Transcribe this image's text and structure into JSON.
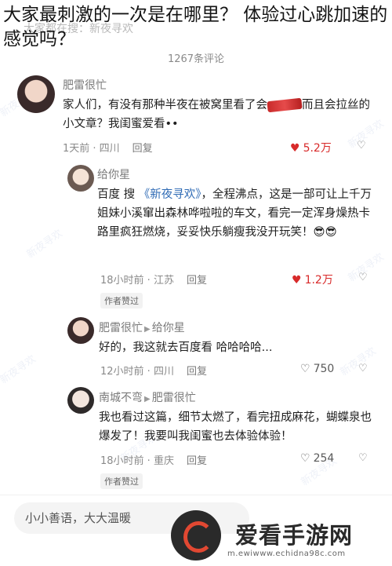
{
  "headline": "大家最刺激的一次是在哪里？ 体验过心跳加速的感觉吗？",
  "search_hint": "大家都在搜：新夜寻欢",
  "comment_count": "1267条评论",
  "watermark_text": "新夜寻欢",
  "comments": [
    {
      "name": "肥雷很忙",
      "text_before": "家人们，有没有那种半夜在被窝里看了会",
      "text_after": "而且会拉丝的小文章？我闺蜜爱看••",
      "time": "1天前 · 四川",
      "reply": "回复",
      "likes": "5.2万",
      "hot": true
    },
    {
      "name": "给你星",
      "text_prefix": "百度 搜",
      "link": "《新夜寻欢》",
      "text": "全程沸点，这是一部可让上千万姐妹小溪窜出森林哗啦啦的车文，看完一定浑身燥热卡路里疯狂燃烧，妥妥快乐躺瘦我没开玩笑！😎😎",
      "time": "18小时前 · 江苏",
      "reply": "回复",
      "likes": "1.2万",
      "hot": true,
      "tag": "作者赞过"
    },
    {
      "name": "肥雷很忙",
      "reply_to": "给你星",
      "text": "好的，我这就去百度看 哈哈哈哈...",
      "time": "12小时前 · 四川",
      "reply": "回复",
      "likes": "750",
      "hot": false
    },
    {
      "name": "南城不弯",
      "reply_to": "肥雷很忙",
      "text": "我也看过这篇，细节太燃了，看完扭成麻花，蝴蝶泉也爆发了！我要叫我闺蜜也去体验体验！",
      "time": "18小时前 · 重庆",
      "reply": "回复",
      "likes": "254",
      "hot": false,
      "tag": "作者赞过"
    }
  ],
  "input_placeholder": "小小善语，大大温暖",
  "brand_name": "爱看手游网",
  "brand_url": "m.ewiwww.echidna98c.com",
  "colors": {
    "like_hot": "#d82a2a",
    "link": "#2f6bb5",
    "meta": "#8a8a8a"
  }
}
